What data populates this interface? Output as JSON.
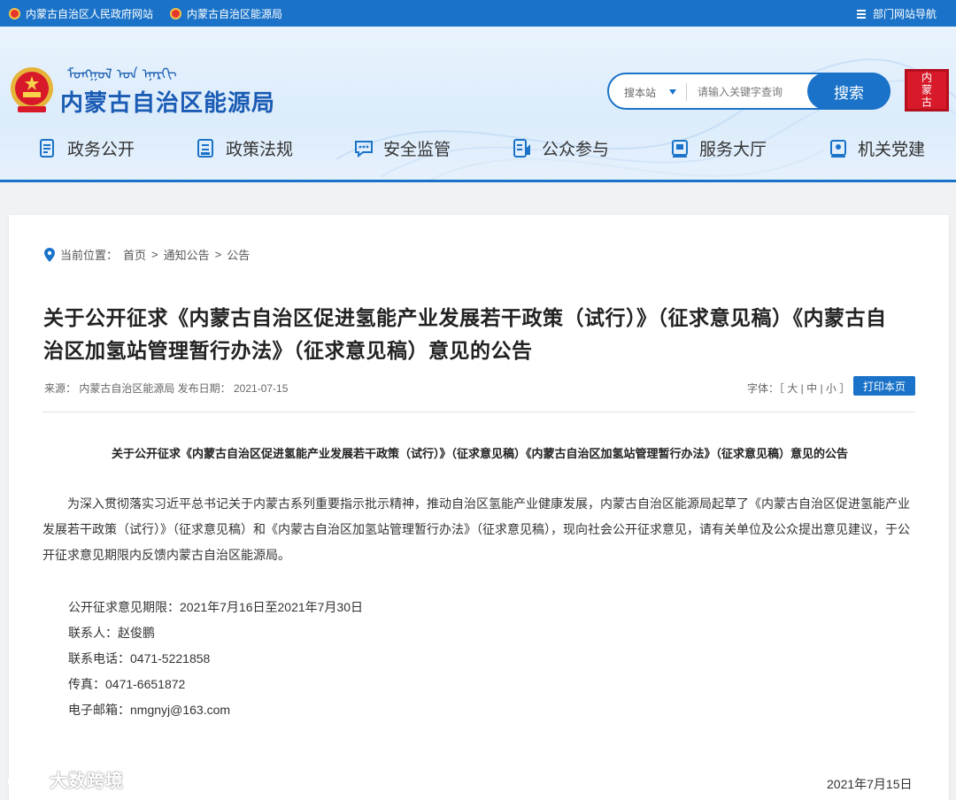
{
  "topbar": {
    "link1": "内蒙古自治区人民政府网站",
    "link2": "内蒙古自治区能源局",
    "nav": "部门网站导航"
  },
  "header": {
    "mongolian_text": "ᠮᠣᠩᠭᠣᠯ ᠤᠨ ᠡᠨᠡᠷᠭᠢ",
    "site_title": "内蒙古自治区能源局",
    "search": {
      "scope": "搜本站",
      "placeholder": "请输入关键字查询",
      "button": "搜索"
    },
    "seal_text": "内蒙古"
  },
  "mainnav": [
    {
      "label": "政务公开",
      "icon": "document-icon"
    },
    {
      "label": "政策法规",
      "icon": "list-icon"
    },
    {
      "label": "安全监管",
      "icon": "chat-icon"
    },
    {
      "label": "公众参与",
      "icon": "edit-icon"
    },
    {
      "label": "服务大厅",
      "icon": "book-icon"
    },
    {
      "label": "机关党建",
      "icon": "card-icon"
    }
  ],
  "breadcrumb": {
    "prefix": "当前位置：",
    "items": [
      "首页",
      "通知公告",
      "公告"
    ],
    "sep": ">"
  },
  "article": {
    "title": "关于公开征求《内蒙古自治区促进氢能产业发展若干政策（试行）》（征求意见稿）《内蒙古自治区加氢站管理暂行办法》（征求意见稿）意见的公告",
    "meta": "来源：  内蒙古自治区能源局  发布日期：  2021-07-15",
    "fontsize": "字体：［ 大 | 中 | 小 ］",
    "print": "打印本页",
    "subtitle": "关于公开征求《内蒙古自治区促进氢能产业发展若干政策（试行）》（征求意见稿）《内蒙古自治区加氢站管理暂行办法》（征求意见稿）意见的公告",
    "body": "为深入贯彻落实习近平总书记关于内蒙古系列重要指示批示精神，推动自治区氢能产业健康发展，内蒙古自治区能源局起草了《内蒙古自治区促进氢能产业发展若干政策（试行）》（征求意见稿）和《内蒙古自治区加氢站管理暂行办法》（征求意见稿），现向社会公开征求意见，请有关单位及公众提出意见建议，于公开征求意见期限内反馈内蒙古自治区能源局。",
    "info": [
      "公开征求意见期限：2021年7月16日至2021年7月30日",
      "联系人：赵俊鹏",
      "联系电话：0471-5221858",
      "传真：0471-6651872",
      "电子邮箱：nmgnyj@163.com"
    ],
    "date": "2021年7月15日"
  },
  "watermark": "大数跨境",
  "colors": {
    "primary": "#1a73c8",
    "title": "#1a5bb4",
    "seal": "#d7192a"
  }
}
